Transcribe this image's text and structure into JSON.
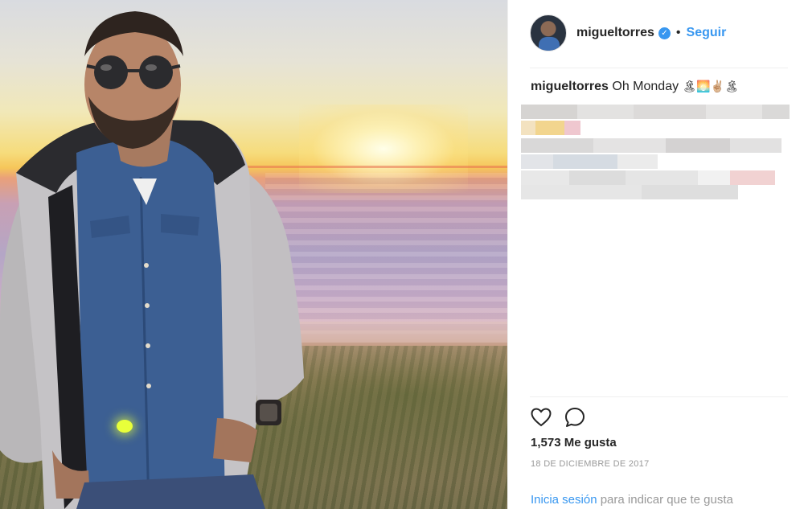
{
  "post": {
    "username": "migueltorres",
    "follow_label": "Seguir",
    "separator": "•",
    "verified_glyph": "✓",
    "caption_text": "Oh Monday",
    "caption_emojis": "🏝🌅✌🏼🏝",
    "likes_text": "1,573 Me gusta",
    "date_text": "18 DE DICIEMBRE DE 2017",
    "login_link": "Inicia sesión",
    "login_rest": " para indicar que te gusta"
  },
  "icons": {
    "like": "heart-icon",
    "comment": "comment-icon",
    "verified": "verified-badge-icon"
  },
  "colors": {
    "accent": "#3897f0",
    "muted": "#999999",
    "text": "#262626",
    "flare": "#e8ff3a"
  }
}
